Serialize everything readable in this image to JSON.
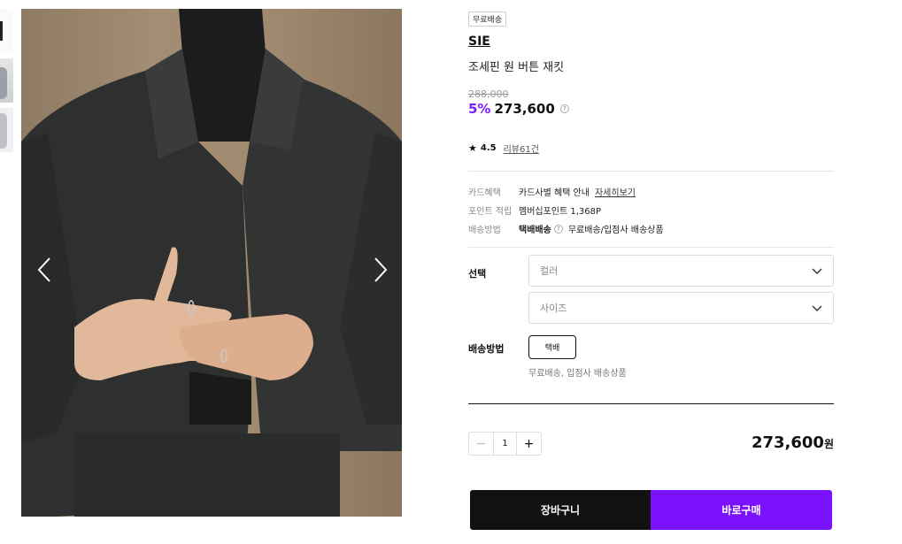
{
  "thumbnails": [
    {
      "name": "thumbnail-1"
    },
    {
      "name": "thumbnail-2"
    },
    {
      "name": "thumbnail-3"
    }
  ],
  "gallery": {
    "prev_icon": "chevron-left-icon",
    "next_icon": "chevron-right-icon"
  },
  "product": {
    "badge": "무료배송",
    "brand": "SIE",
    "name": "조세핀 원 버튼 재킷",
    "original_price": "288,000",
    "discount": "5%",
    "price": "273,600",
    "rating": "4.5",
    "review_link": "리뷰61건"
  },
  "info": {
    "card_label": "카드혜택",
    "card_value": "카드사별 혜택 안내",
    "card_link": "자세히보기",
    "point_label": "포인트 적립",
    "point_value": "멤버십포인트 1,368P",
    "ship_label": "배송방법",
    "ship_method": "택배배송",
    "ship_value": "무료배송/입점사 배송상품"
  },
  "options": {
    "select_label": "선택",
    "color_placeholder": "컬러",
    "size_placeholder": "사이즈",
    "ship_label": "배송방법",
    "ship_button": "택배",
    "ship_note": "무료배송, 입점사 배송상품"
  },
  "order": {
    "quantity": "1",
    "minus": "−",
    "plus": "+",
    "total": "273,600",
    "currency": "원"
  },
  "buttons": {
    "cart": "장바구니",
    "buy": "바로구매"
  },
  "colors": {
    "accent": "#7a11ff",
    "discount": "#7a1fff",
    "dark": "#111111"
  }
}
